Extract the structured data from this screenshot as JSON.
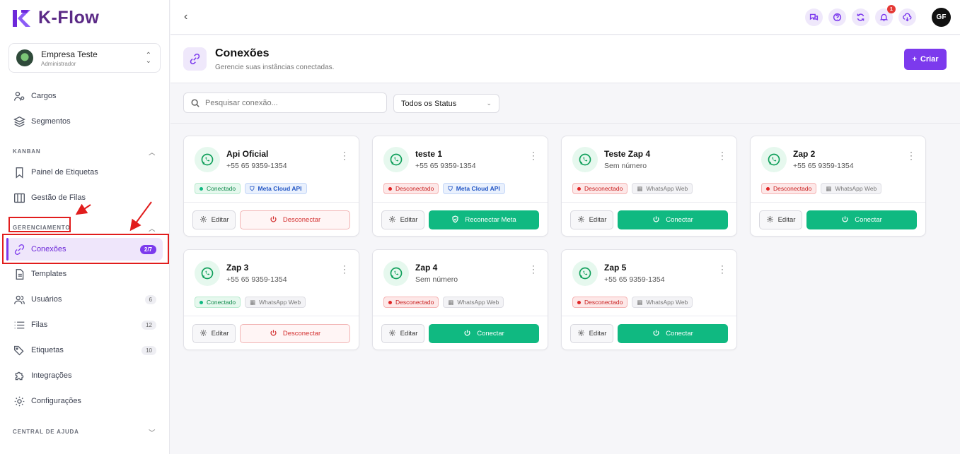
{
  "app": {
    "name": "K-Flow"
  },
  "company": {
    "name": "Empresa Teste",
    "role": "Administrador"
  },
  "sidebar": {
    "items_top": [
      {
        "label": "Cargos",
        "icon": "roles-icon"
      },
      {
        "label": "Segmentos",
        "icon": "layers-icon"
      }
    ],
    "kanban": {
      "title": "KANBAN",
      "items": [
        {
          "label": "Painel de Etiquetas",
          "icon": "bookmark-icon"
        },
        {
          "label": "Gestão de Filas",
          "icon": "columns-icon"
        }
      ]
    },
    "management": {
      "title": "GERENCIAMENTO",
      "items": [
        {
          "label": "Conexões",
          "icon": "link-icon",
          "count": "2/7",
          "active": true
        },
        {
          "label": "Templates",
          "icon": "document-icon"
        },
        {
          "label": "Usuários",
          "icon": "users-icon",
          "count": "6"
        },
        {
          "label": "Filas",
          "icon": "list-icon",
          "count": "12"
        },
        {
          "label": "Etiquetas",
          "icon": "tags-icon",
          "count": "10"
        },
        {
          "label": "Integrações",
          "icon": "puzzle-icon"
        },
        {
          "label": "Configurações",
          "icon": "settings-icon"
        }
      ]
    },
    "help": {
      "title": "CENTRAL DE AJUDA"
    }
  },
  "topbar": {
    "notifications_count": "1",
    "user_initials": "GF"
  },
  "page": {
    "title": "Conexões",
    "subtitle": "Gerencie suas instâncias conectadas.",
    "create_label": "Criar"
  },
  "filters": {
    "search_placeholder": "Pesquisar conexão...",
    "status_value": "Todos os Status"
  },
  "labels": {
    "edit": "Editar",
    "disconnect": "Desconectar",
    "connect": "Conectar",
    "reconnect_meta": "Reconectar Meta",
    "connected": "Conectado",
    "disconnected": "Desconectado",
    "meta_api": "Meta Cloud API",
    "whatsapp_web": "WhatsApp Web"
  },
  "connections": [
    {
      "name": "Api Oficial",
      "phone": "+55 65 9359-1354",
      "status": "Conectado",
      "type": "Meta Cloud API",
      "action": "Desconectar"
    },
    {
      "name": "teste 1",
      "phone": "+55 65 9359-1354",
      "status": "Desconectado",
      "type": "Meta Cloud API",
      "action": "Reconectar Meta"
    },
    {
      "name": "Teste Zap 4",
      "phone": "Sem número",
      "status": "Desconectado",
      "type": "WhatsApp Web",
      "action": "Conectar"
    },
    {
      "name": "Zap 2",
      "phone": "+55 65 9359-1354",
      "status": "Desconectado",
      "type": "WhatsApp Web",
      "action": "Conectar"
    },
    {
      "name": "Zap 3",
      "phone": "+55 65 9359-1354",
      "status": "Conectado",
      "type": "WhatsApp Web",
      "action": "Desconectar"
    },
    {
      "name": "Zap 4",
      "phone": "Sem número",
      "status": "Desconectado",
      "type": "WhatsApp Web",
      "action": "Conectar"
    },
    {
      "name": "Zap 5",
      "phone": "+55 65 9359-1354",
      "status": "Desconectado",
      "type": "WhatsApp Web",
      "action": "Conectar"
    }
  ],
  "colors": {
    "accent": "#7c3aed",
    "success": "#10b981",
    "danger": "#d32f2f",
    "annotation": "#e11d1d"
  }
}
